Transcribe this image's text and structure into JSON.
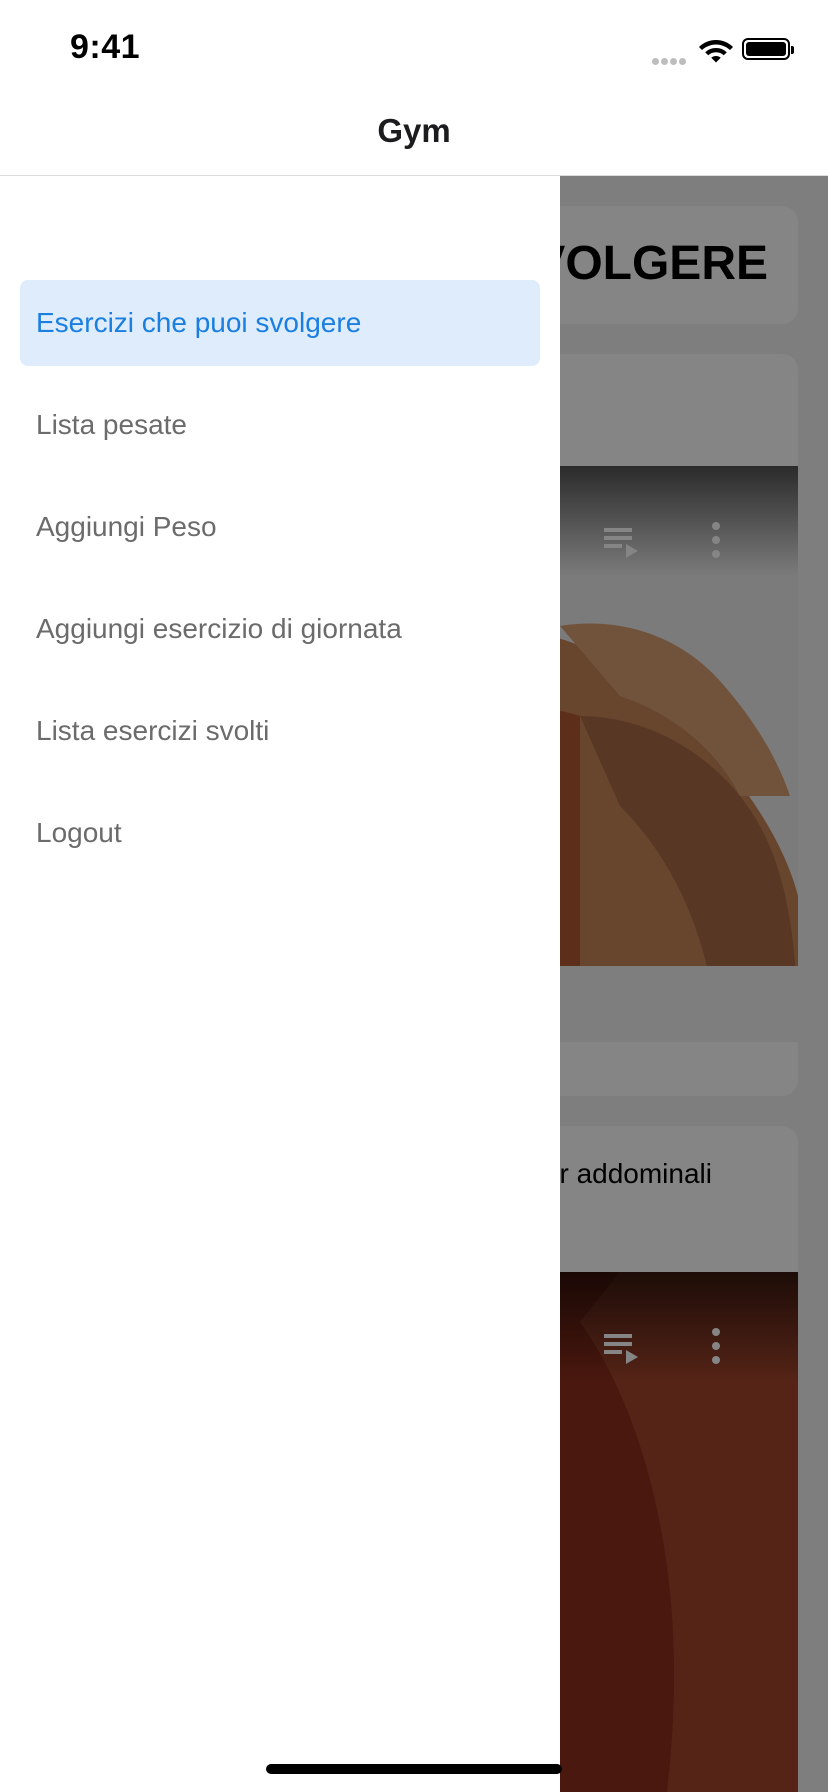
{
  "status_bar": {
    "time": "9:41"
  },
  "header": {
    "title": "Gym"
  },
  "drawer": {
    "items": [
      {
        "label": "Esercizi che puoi svolgere",
        "active": true
      },
      {
        "label": "Lista pesate",
        "active": false
      },
      {
        "label": "Aggiungi Peso",
        "active": false
      },
      {
        "label": "Aggiungi esercizio di giornata",
        "active": false
      },
      {
        "label": "Lista esercizi svolti",
        "active": false
      },
      {
        "label": "Logout",
        "active": false
      }
    ]
  },
  "content": {
    "heading_visible_fragment": "VOLGERE",
    "cards": [
      {
        "label_visible_fragment": ""
      },
      {
        "label_visible_fragment": "r addominali"
      }
    ]
  },
  "icons": {
    "wifi": "wifi-icon",
    "battery": "battery-icon",
    "signal": "signal-dots-icon",
    "playlist": "playlist-play-icon",
    "more": "more-vertical-icon"
  },
  "colors": {
    "accent": "#1a7fe0",
    "active_item_bg": "#deecfb",
    "drawer_text": "#6b6b6b",
    "scrim": "rgba(0,0,0,0.48)"
  }
}
